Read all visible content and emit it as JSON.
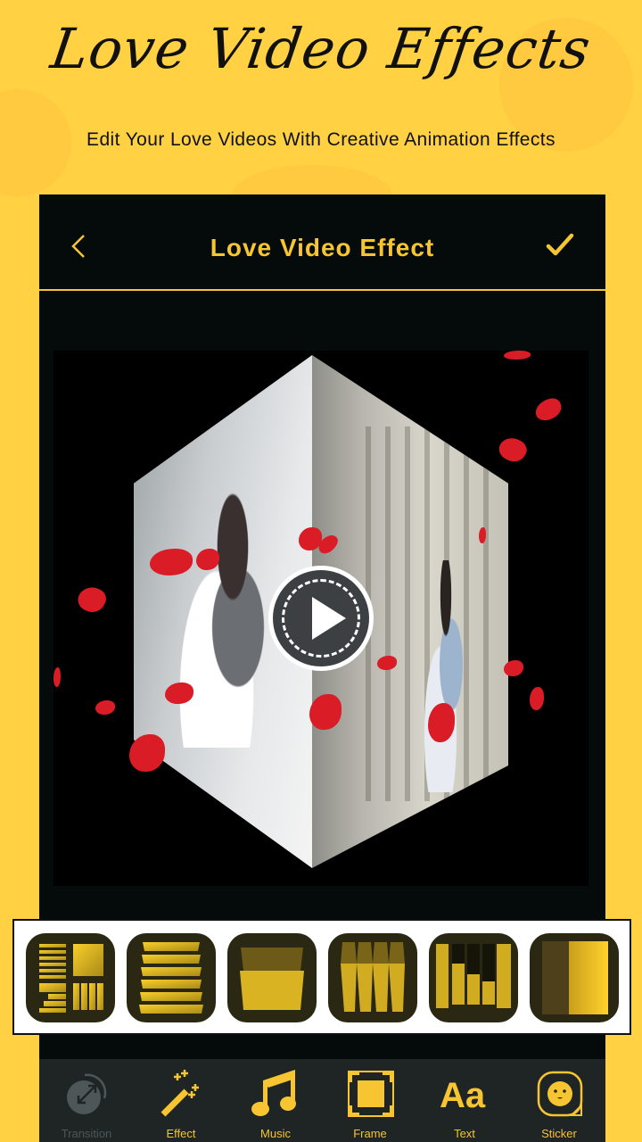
{
  "promo": {
    "title": "Love Video Effects",
    "subtitle": "Edit Your Love Videos With Creative Animation Effects"
  },
  "header": {
    "title": "Love Video Effect",
    "back_icon": "chevron-left-icon",
    "confirm_icon": "checkmark-icon"
  },
  "preview": {
    "play_icon": "play-icon"
  },
  "effects": [
    {
      "name": "mixed-transition"
    },
    {
      "name": "horizontal-blinds"
    },
    {
      "name": "cube-box"
    },
    {
      "name": "vertical-strips"
    },
    {
      "name": "bar-steps"
    },
    {
      "name": "split-slide"
    }
  ],
  "bottom_nav": [
    {
      "label": "Transition",
      "icon": "transition-icon",
      "active": false
    },
    {
      "label": "Effect",
      "icon": "magic-wand-icon",
      "active": true
    },
    {
      "label": "Music",
      "icon": "music-note-icon",
      "active": true
    },
    {
      "label": "Frame",
      "icon": "frame-icon",
      "active": true
    },
    {
      "label": "Text",
      "icon": "text-icon",
      "active": true
    },
    {
      "label": "Sticker",
      "icon": "sticker-icon",
      "active": true
    }
  ],
  "colors": {
    "background": "#ffd143",
    "accent": "#f7c531",
    "panel": "#050b0b",
    "nav": "#1f2424"
  }
}
